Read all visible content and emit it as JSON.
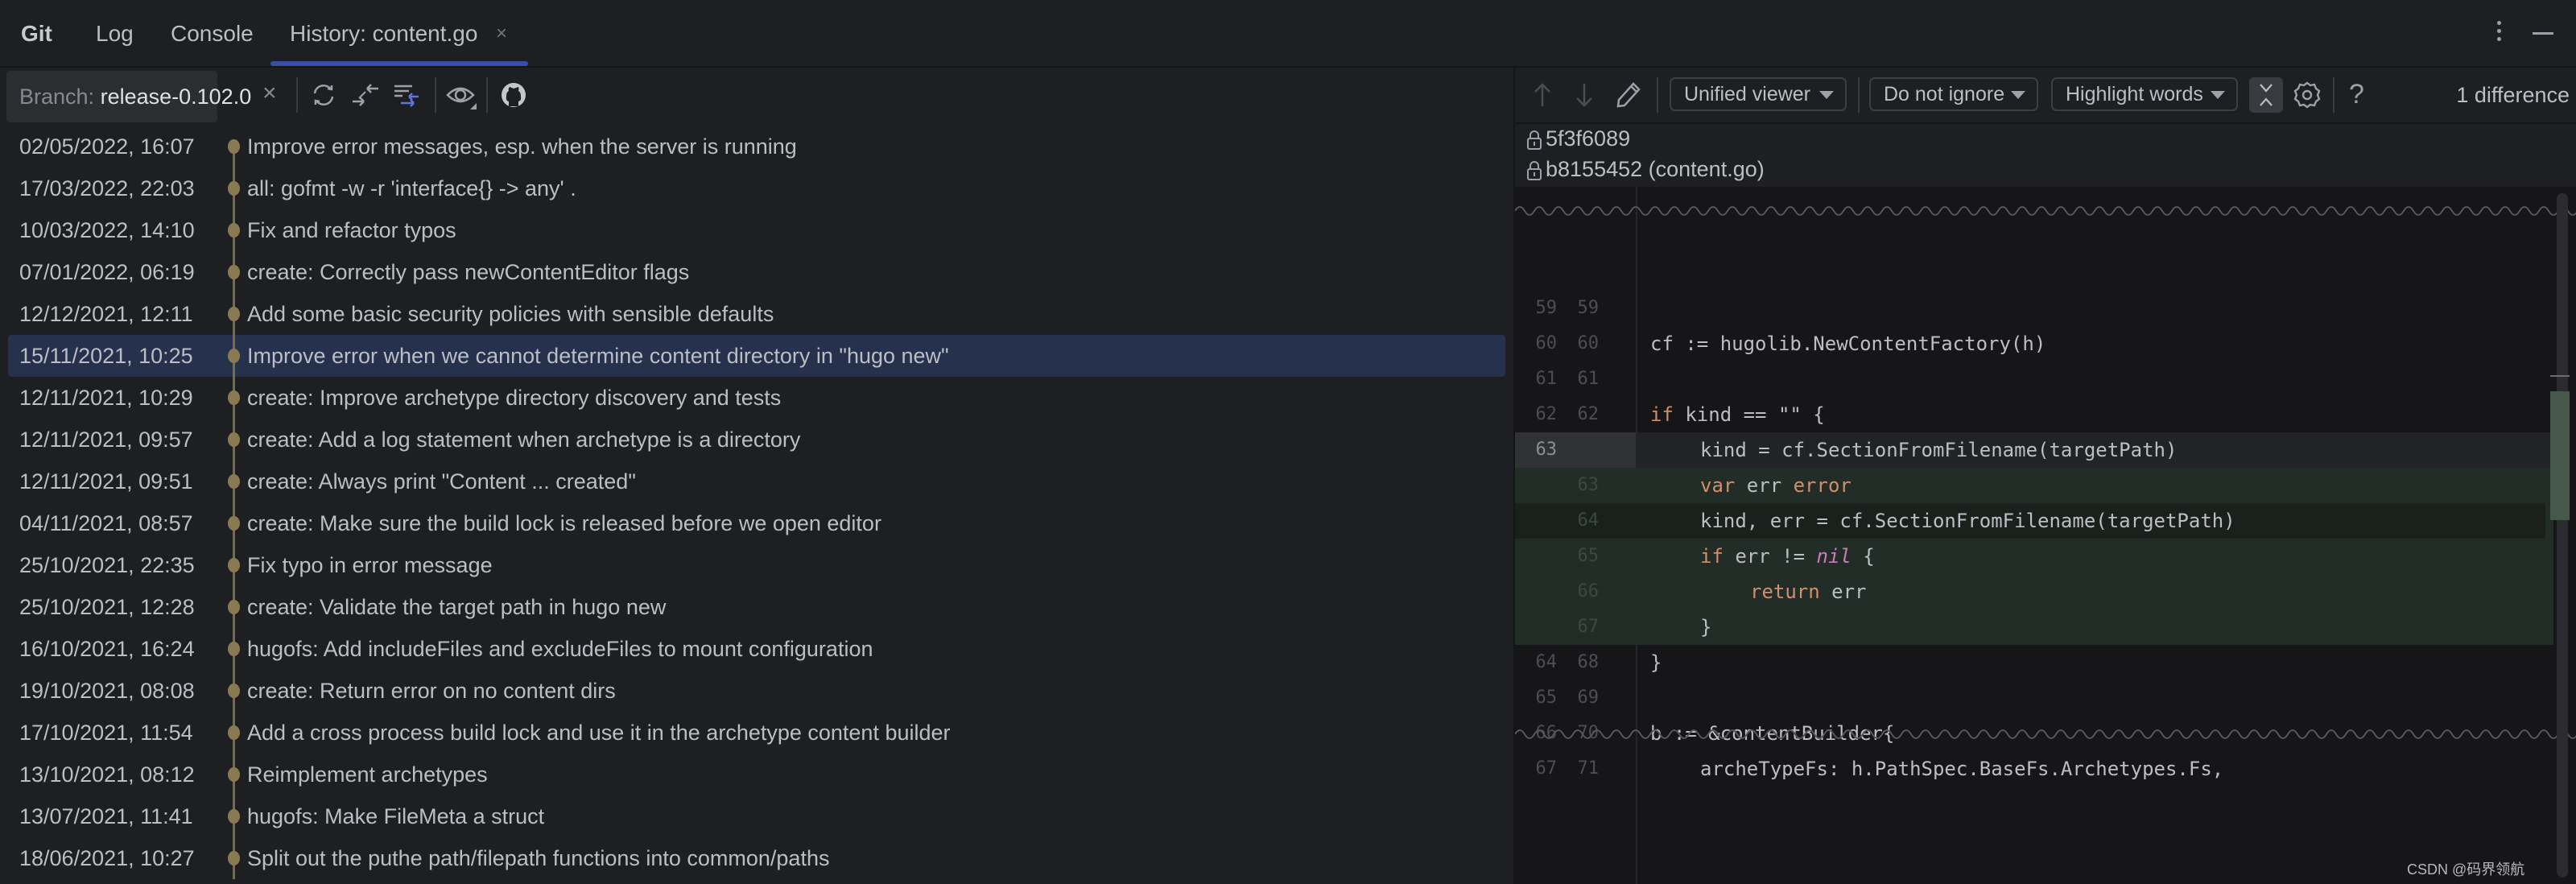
{
  "tabs": [
    {
      "label": "Git",
      "active": false,
      "bold": true
    },
    {
      "label": "Log",
      "active": false
    },
    {
      "label": "Console",
      "active": false
    },
    {
      "label": "History: content.go",
      "active": true,
      "closable": true
    }
  ],
  "window_actions": {
    "more_icon": "kebab-vertical-icon",
    "minimize_icon": "minimize-icon"
  },
  "history_toolbar": {
    "branch_label": "Branch:",
    "branch_value": "release-0.102.0",
    "branch_clear": "×",
    "icons": [
      "refresh-icon",
      "collapse-linear-branches-icon",
      "intellisort-icon",
      "view-options-icon",
      "github-icon"
    ]
  },
  "commits": [
    {
      "date": "02/05/2022, 16:07",
      "message": "Improve error messages, esp. when the server is running"
    },
    {
      "date": "17/03/2022, 22:03",
      "message": "all: gofmt -w -r 'interface{} -> any' ."
    },
    {
      "date": "10/03/2022, 14:10",
      "message": "Fix and refactor typos"
    },
    {
      "date": "07/01/2022, 06:19",
      "message": "create: Correctly pass newContentEditor flags"
    },
    {
      "date": "12/12/2021, 12:11",
      "message": "Add some basic security policies with sensible defaults"
    },
    {
      "date": "15/11/2021, 10:25",
      "message": "Improve error when we cannot determine content directory in \"hugo new\"",
      "selected": true
    },
    {
      "date": "12/11/2021, 10:29",
      "message": "create: Improve archetype directory discovery and tests"
    },
    {
      "date": "12/11/2021, 09:57",
      "message": "create: Add a log statement when archetype is a directory"
    },
    {
      "date": "12/11/2021, 09:51",
      "message": "create: Always print \"Content ... created\""
    },
    {
      "date": "04/11/2021, 08:57",
      "message": "create: Make sure the build lock is released before we open editor"
    },
    {
      "date": "25/10/2021, 22:35",
      "message": "Fix typo in error message"
    },
    {
      "date": "25/10/2021, 12:28",
      "message": "create: Validate the target path in hugo new"
    },
    {
      "date": "16/10/2021, 16:24",
      "message": "hugofs: Add includeFiles and excludeFiles to mount configuration"
    },
    {
      "date": "19/10/2021, 08:08",
      "message": "create: Return error on no content dirs"
    },
    {
      "date": "17/10/2021, 11:54",
      "message": "Add a cross process build lock and use it in the archetype content builder"
    },
    {
      "date": "13/10/2021, 08:12",
      "message": "Reimplement archetypes"
    },
    {
      "date": "13/07/2021, 11:41",
      "message": "hugofs: Make FileMeta a struct"
    },
    {
      "date": "18/06/2021, 10:27",
      "message": "Split out the puthe path/filepath functions into common/paths"
    }
  ],
  "diff_toolbar": {
    "viewer": "Unified viewer",
    "ignore": "Do not ignore",
    "highlight": "Highlight words",
    "difference_count": "1 difference",
    "icons": [
      "prev-diff-icon",
      "next-diff-icon",
      "edit-icon",
      "collapse-unchanged-icon",
      "settings-icon",
      "help-icon"
    ]
  },
  "revisions": [
    {
      "label": "5f3f6089"
    },
    {
      "label": "b8155452 (content.go)"
    }
  ],
  "code_lines": [
    {
      "old": "59",
      "new": "59",
      "type": "context",
      "indent": 0,
      "text": ""
    },
    {
      "old": "60",
      "new": "60",
      "type": "context",
      "indent": 1,
      "text": "cf := hugolib.NewContentFactory(h)"
    },
    {
      "old": "61",
      "new": "61",
      "type": "context",
      "indent": 0,
      "text": ""
    },
    {
      "old": "62",
      "new": "62",
      "type": "context",
      "indent": 1,
      "text": "if kind == \"\" {"
    },
    {
      "old": "63",
      "new": "",
      "type": "removed",
      "indent": 2,
      "text": "kind = cf.SectionFromFilename(targetPath)"
    },
    {
      "old": "",
      "new": "63",
      "type": "added",
      "indent": 2,
      "text": "var err error"
    },
    {
      "old": "",
      "new": "64",
      "type": "added",
      "indent": 2,
      "text": "kind, err = cf.SectionFromFilename(targetPath)"
    },
    {
      "old": "",
      "new": "65",
      "type": "added",
      "indent": 2,
      "text": "if err != nil {"
    },
    {
      "old": "",
      "new": "66",
      "type": "added",
      "indent": 3,
      "text": "return err"
    },
    {
      "old": "",
      "new": "67",
      "type": "added",
      "indent": 2,
      "text": "}"
    },
    {
      "old": "64",
      "new": "68",
      "type": "context",
      "indent": 1,
      "text": "}"
    },
    {
      "old": "65",
      "new": "69",
      "type": "context",
      "indent": 0,
      "text": ""
    },
    {
      "old": "66",
      "new": "70",
      "type": "context",
      "indent": 1,
      "text": "b := &contentBuilder{"
    },
    {
      "old": "67",
      "new": "71",
      "type": "context",
      "indent": 2,
      "text": "archeTypeFs: h.PathSpec.BaseFs.Archetypes.Fs,"
    }
  ],
  "colors": {
    "accent_tab": "#3b4ea6",
    "selected_row": "#25314d",
    "graph": "#8a7a52",
    "added_bg": "#232d27",
    "keyword": "#cf8e6d",
    "nil": "#c77dbb"
  },
  "watermark": "CSDN @码界领航"
}
